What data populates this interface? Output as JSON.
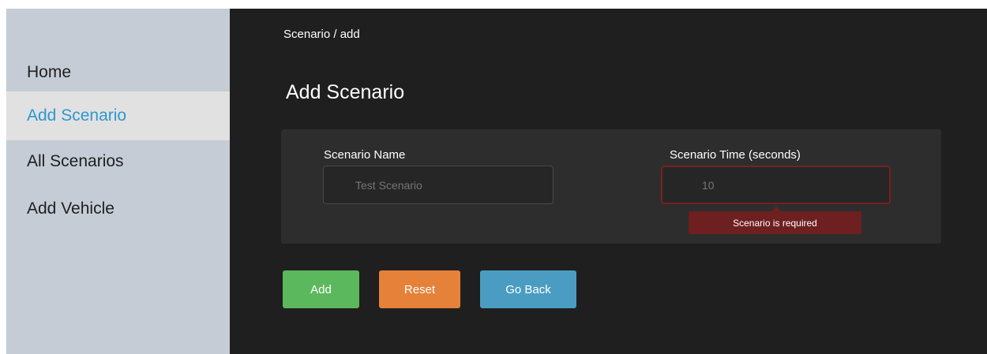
{
  "sidebar": {
    "items": [
      {
        "label": "Home",
        "active": false
      },
      {
        "label": "Add Scenario",
        "active": true
      },
      {
        "label": "All Scenarios",
        "active": false
      },
      {
        "label": "Add Vehicle",
        "active": false
      }
    ]
  },
  "main": {
    "breadcrumb": "Scenario / add",
    "title": "Add Scenario",
    "form": {
      "name": {
        "label": "Scenario Name",
        "placeholder": "Test Scenario",
        "value": ""
      },
      "time": {
        "label": "Scenario Time (seconds)",
        "placeholder": "10",
        "value": "",
        "error": "Scenario is required"
      }
    },
    "buttons": {
      "add": "Add",
      "reset": "Reset",
      "back": "Go Back"
    }
  },
  "colors": {
    "sidebar_bg": "#c5ccd5",
    "active_item_bg": "#e1e1e1",
    "active_item_text": "#2e97d1",
    "main_bg": "#1f1f1f",
    "card_bg": "#2d2d2d",
    "error_bg": "#6e1f20",
    "add_button": "#5cb85c",
    "reset_button": "#e6813a",
    "back_button": "#4b9cc2"
  }
}
